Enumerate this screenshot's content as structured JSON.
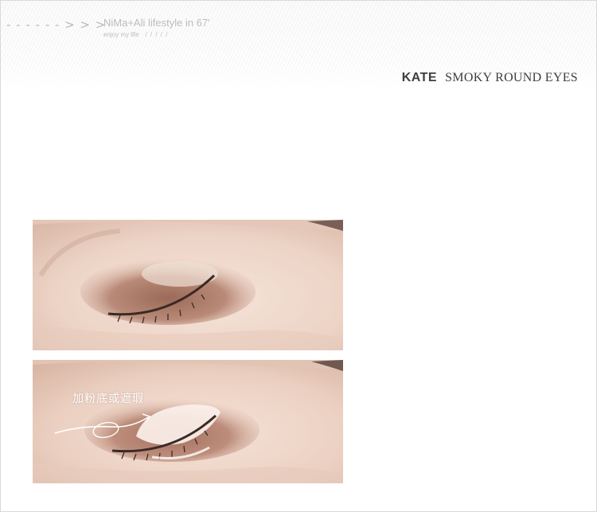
{
  "header": {
    "decoration": "- - - - - - > > >",
    "brand_line": "NiMa+Ali lifestyle in 67'",
    "brand_sub": "enjoy my life",
    "brand_sub_slashes": "/ / / / /"
  },
  "product": {
    "brand": "KATE",
    "name": "SMOKY ROUND EYES"
  },
  "photos": [
    {
      "subject": "closed eye with brown eyeshadow"
    },
    {
      "subject": "closed eye with concealer base applied",
      "annotation": "加粉底或遮瑕"
    }
  ]
}
